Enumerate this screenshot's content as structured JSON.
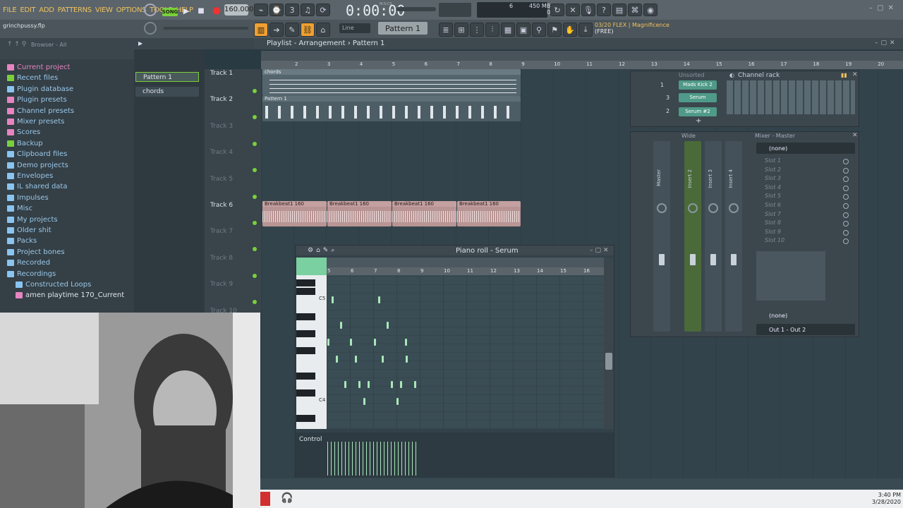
{
  "menu": [
    "FILE",
    "EDIT",
    "ADD",
    "PATTERNS",
    "VIEW",
    "OPTIONS",
    "TOOLS",
    "HELP"
  ],
  "transport": {
    "song_mode": "SONG",
    "tempo": "160.000",
    "time": "0:00:00",
    "time_unit": "M:S:CS",
    "cpu": "6",
    "ram": "450 MB",
    "voices": "0"
  },
  "project_name": "grinchpussy.flp",
  "hint": {
    "line1": "03/20  FLEX | Magnificence",
    "line2": "(FREE)"
  },
  "snap": "Line",
  "pattern_selector": "Pattern 1",
  "browser": {
    "title": "Browser - All",
    "items": [
      {
        "label": "Current project",
        "color": "#e884c0"
      },
      {
        "label": "Recent files",
        "color": "#7ad03b"
      },
      {
        "label": "Plugin database",
        "color": "#8ac4f0"
      },
      {
        "label": "Plugin presets",
        "color": "#e884c0"
      },
      {
        "label": "Channel presets",
        "color": "#e884c0"
      },
      {
        "label": "Mixer presets",
        "color": "#e884c0"
      },
      {
        "label": "Scores",
        "color": "#e884c0"
      },
      {
        "label": "Backup",
        "color": "#7ad03b"
      },
      {
        "label": "Clipboard files",
        "color": "#8ac4f0"
      },
      {
        "label": "Demo projects",
        "color": "#8ac4f0"
      },
      {
        "label": "Envelopes",
        "color": "#8ac4f0"
      },
      {
        "label": "IL shared data",
        "color": "#8ac4f0"
      },
      {
        "label": "Impulses",
        "color": "#8ac4f0"
      },
      {
        "label": "Misc",
        "color": "#8ac4f0"
      },
      {
        "label": "My projects",
        "color": "#8ac4f0"
      },
      {
        "label": "Older shit",
        "color": "#8ac4f0"
      },
      {
        "label": "Packs",
        "color": "#8ac4f0"
      },
      {
        "label": "Project bones",
        "color": "#8ac4f0"
      },
      {
        "label": "Recorded",
        "color": "#8ac4f0"
      },
      {
        "label": "Recordings",
        "color": "#8ac4f0"
      },
      {
        "label": "Constructed Loops",
        "color": "#8ac4f0"
      },
      {
        "label": "amen playtime 170_Current",
        "color": "#e884c0"
      }
    ]
  },
  "patterns": [
    "Pattern 1",
    "chords"
  ],
  "playlist": {
    "title": "Playlist - Arrangement  ›  Pattern 1",
    "ruler": [
      "2",
      "3",
      "4",
      "5",
      "6",
      "7",
      "8",
      "9",
      "10",
      "11",
      "12",
      "13",
      "14",
      "15",
      "16",
      "17",
      "18",
      "19",
      "20"
    ],
    "tracks": [
      "Track 1",
      "Track 2",
      "Track 3",
      "Track 4",
      "Track 5",
      "Track 6",
      "Track 7",
      "Track 8",
      "Track 9",
      "Track 10"
    ],
    "clips": [
      {
        "label": "chords"
      },
      {
        "label": "Pattern 1"
      },
      {
        "label": "Breakbeat1 160"
      },
      {
        "label": "Breakbeat1 160"
      },
      {
        "label": "Breakbeat1 160"
      },
      {
        "label": "Breakbeat1 160"
      }
    ]
  },
  "channel_rack": {
    "title": "Channel rack",
    "filter": "Unsorted",
    "channels": [
      {
        "num": "1",
        "name": "Mads Kick 2"
      },
      {
        "num": "3",
        "name": "Serum"
      },
      {
        "num": "2",
        "name": "Serum #2"
      }
    ]
  },
  "mixer": {
    "title": "Mixer - Master",
    "preset": "Wide",
    "tracks": [
      "Master",
      "Insert 2",
      "Insert 3",
      "Insert 4"
    ],
    "slot_header": "(none)",
    "slots": [
      "Slot 1",
      "Slot 2",
      "Slot 3",
      "Slot 4",
      "Slot 5",
      "Slot 6",
      "Slot 7",
      "Slot 8",
      "Slot 9",
      "Slot 10"
    ],
    "eq": "(none)",
    "output": "Out 1 - Out 2"
  },
  "piano_roll": {
    "title": "Piano roll - Serum",
    "ruler": [
      "5",
      "6",
      "7",
      "8",
      "9",
      "10",
      "11",
      "12",
      "13",
      "14",
      "15",
      "16"
    ],
    "keys": [
      "C5",
      "C4"
    ],
    "control": "Control"
  },
  "clock": {
    "time": "3:40 PM",
    "date": "3/28/2020"
  },
  "colors": {
    "accent": "#f0c060",
    "clip_audio": "#c89a9a",
    "clip_pattern": "#5a6a72",
    "note": "#a8e8b8",
    "mixer_sel": "#7ad03b"
  }
}
